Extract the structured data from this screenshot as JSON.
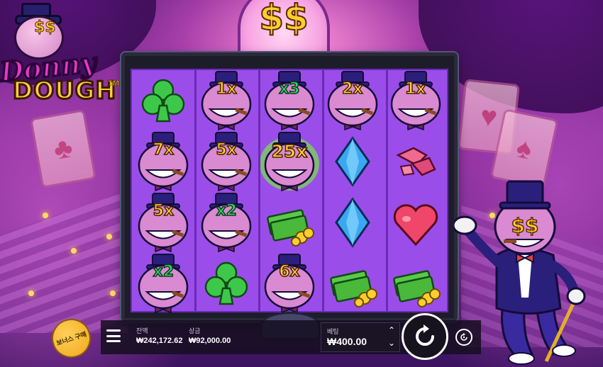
{
  "game": {
    "logo_line1": "Donny",
    "logo_line2": "DOUGH",
    "logo_tm": "TM",
    "sign_text": "$$",
    "mascot_eyes": "$$"
  },
  "reels": [
    [
      {
        "symbol": "club"
      },
      {
        "symbol": "donny",
        "mult": "7x"
      },
      {
        "symbol": "donny",
        "mult": "5x"
      },
      {
        "symbol": "donny",
        "mult": "x2",
        "color": "green"
      }
    ],
    [
      {
        "symbol": "donny",
        "mult": "1x"
      },
      {
        "symbol": "donny",
        "mult": "5x"
      },
      {
        "symbol": "donny",
        "mult": "x2",
        "color": "green"
      },
      {
        "symbol": "club"
      }
    ],
    [
      {
        "symbol": "donny",
        "mult": "x3",
        "color": "green"
      },
      {
        "symbol": "donny-golden",
        "mult": "25x"
      },
      {
        "symbol": "cash"
      },
      {
        "symbol": "donny",
        "mult": "6x"
      }
    ],
    [
      {
        "symbol": "donny",
        "mult": "2x"
      },
      {
        "symbol": "diamond"
      },
      {
        "symbol": "diamond"
      },
      {
        "symbol": "cash"
      }
    ],
    [
      {
        "symbol": "donny",
        "mult": "1x"
      },
      {
        "symbol": "gems"
      },
      {
        "symbol": "heart"
      },
      {
        "symbol": "cash"
      }
    ]
  ],
  "controls": {
    "bonus_buy_label": "보너스 구매",
    "balance_label": "잔액",
    "balance_value": "₩242,172.62",
    "win_label": "상금",
    "win_value": "₩92,000.00",
    "bet_label": "베팅",
    "bet_value": "₩400.00",
    "bet_up_icon": "chevron-up-icon",
    "bet_down_icon": "chevron-down-icon",
    "spin_icon": "spin-arrow-icon",
    "autoplay_icon": "autoplay-icon",
    "menu_icon": "hamburger-menu-icon"
  },
  "colors": {
    "reel_bg": "#9b4dea",
    "gold": "#ffd23a",
    "green_mult": "#39d36a"
  }
}
